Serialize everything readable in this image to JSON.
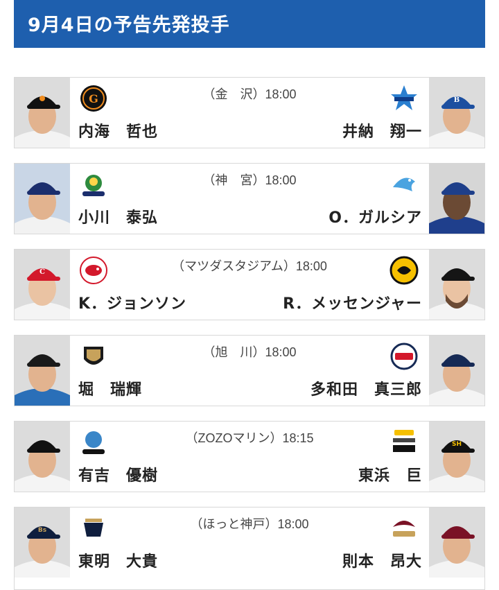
{
  "header": {
    "title": "9月4日の予告先発投手"
  },
  "games": [
    {
      "venue": "（金　沢）18:00",
      "home": {
        "pitcher": "内海　哲也",
        "team_logo": "giants-logo",
        "cap": "#111111",
        "jersey": "#f3f3f3"
      },
      "away": {
        "pitcher": "井納　翔一",
        "team_logo": "baystars-logo",
        "cap": "#1c4fa0",
        "jersey": "#f5f5f5"
      }
    },
    {
      "venue": "（神　宮）18:00",
      "home": {
        "pitcher": "小川　泰弘",
        "team_logo": "swallows-logo",
        "cap": "#1b2e6d",
        "jersey": "#f2f2f2"
      },
      "away": {
        "pitcher": "O．ガルシア",
        "team_logo": "dragons-logo",
        "cap": "#1e3f8a",
        "jersey": "#1f3f8c"
      }
    },
    {
      "venue": "（マツダスタジアム）18:00",
      "home": {
        "pitcher": "K．ジョンソン",
        "team_logo": "carp-logo",
        "cap": "#d3182b",
        "jersey": "#f4f4f4"
      },
      "away": {
        "pitcher": "R．メッセンジャー",
        "team_logo": "tigers-logo",
        "cap": "#151515",
        "jersey": "#f4f4f4"
      }
    },
    {
      "venue": "（旭　川）18:00",
      "home": {
        "pitcher": "堀　瑞輝",
        "team_logo": "fighters-logo",
        "cap": "#1a1a1a",
        "jersey": "#2a6fb8"
      },
      "away": {
        "pitcher": "多和田　真三郎",
        "team_logo": "lions-logo",
        "cap": "#162a55",
        "jersey": "#f4f4f4"
      }
    },
    {
      "venue": "（ZOZOマリン）18:15",
      "home": {
        "pitcher": "有吉　優樹",
        "team_logo": "marines-logo",
        "cap": "#111111",
        "jersey": "#f4f4f4"
      },
      "away": {
        "pitcher": "東浜　巨",
        "team_logo": "hawks-logo",
        "cap": "#111111",
        "jersey": "#f4f4f4"
      }
    },
    {
      "venue": "（ほっと神戸）18:00",
      "home": {
        "pitcher": "東明　大貴",
        "team_logo": "buffaloes-logo",
        "cap": "#0f1e3e",
        "jersey": "#f4f4f4"
      },
      "away": {
        "pitcher": "則本　昂大",
        "team_logo": "eagles-logo",
        "cap": "#7a1226",
        "jersey": "#f4f4f4"
      }
    }
  ]
}
